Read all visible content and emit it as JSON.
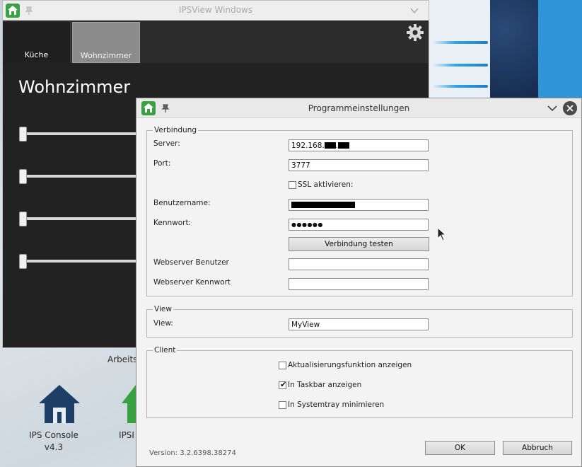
{
  "ipsview": {
    "title": "IPSView Windows",
    "tabs": [
      {
        "label": "Küche"
      },
      {
        "label": "Wohnzimmer"
      }
    ],
    "room_title": "Wohnzimmer"
  },
  "desktop": {
    "ips_console_label": "IPS Console",
    "ips_console_version": "v4.3",
    "ips_second_label": "IPSI",
    "arbeits_text": "Arbeits"
  },
  "dialog": {
    "title": "Programmeinstellungen",
    "verbindung": {
      "legend": "Verbindung",
      "server_label": "Server:",
      "server_value": "192.168.",
      "server_dot": ".",
      "port_label": "Port:",
      "port_value": "3777",
      "ssl_label": "SSL aktivieren:",
      "ssl_checked": false,
      "benutzername_label": "Benutzername:",
      "kennwort_label": "Kennwort:",
      "kennwort_value": "●●●●●●",
      "test_button": "Verbindung testen",
      "webserver_benutzer_label": "Webserver Benutzer",
      "webserver_kennwort_label": "Webserver Kennwort"
    },
    "view": {
      "legend": "View",
      "view_label": "View:",
      "view_value": "MyView"
    },
    "client": {
      "legend": "Client",
      "update_label": "Aktualisierungsfunktion anzeigen",
      "update_checked": false,
      "taskbar_label": "In Taskbar anzeigen",
      "taskbar_checked": true,
      "taskbar_mark": "✔",
      "systray_label": "In Systemtray minimieren",
      "systray_checked": false
    },
    "version": "Version: 3.2.6398.38274",
    "ok_button": "OK",
    "cancel_button": "Abbruch"
  },
  "colors": {
    "accent_green": "#3aa142",
    "ips_blue": "#1d3f66"
  }
}
